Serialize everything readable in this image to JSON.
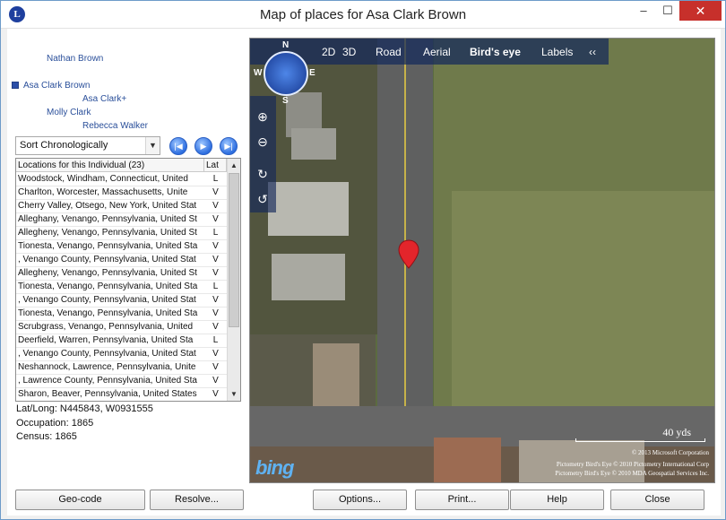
{
  "window": {
    "title": "Map of places for Asa Clark Brown",
    "app_icon": "L"
  },
  "titlebar": {
    "minimize": "–",
    "maximize": "☐",
    "close": "✕"
  },
  "tree": [
    {
      "label": "Nathan Brown",
      "selected": false
    },
    {
      "label": "Asa Clark Brown",
      "selected": true
    },
    {
      "label": "Asa Clark+",
      "selected": false
    },
    {
      "label": "Molly Clark",
      "selected": false
    },
    {
      "label": "Rebecca Walker",
      "selected": false
    }
  ],
  "sort": {
    "selected": "Sort Chronologically"
  },
  "nav_buttons": {
    "first": "|◀",
    "play": "▶",
    "last": "▶|"
  },
  "list": {
    "columns": [
      "Locations for this Individual (23)",
      "Lat"
    ],
    "rows": [
      {
        "location": "Woodstock, Windham, Connecticut, United",
        "lat": "L"
      },
      {
        "location": "Charlton, Worcester, Massachusetts, Unite",
        "lat": "V"
      },
      {
        "location": "Cherry Valley, Otsego, New York, United Stat",
        "lat": "V"
      },
      {
        "location": "Alleghany, Venango, Pennsylvania, United St",
        "lat": "V"
      },
      {
        "location": "Allegheny, Venango, Pennsylvania, United St",
        "lat": "L"
      },
      {
        "location": "Tionesta, Venango, Pennsylvania, United Sta",
        "lat": "V"
      },
      {
        "location": ", Venango County, Pennsylvania, United Stat",
        "lat": "V"
      },
      {
        "location": "Allegheny, Venango, Pennsylvania, United St",
        "lat": "V"
      },
      {
        "location": "Tionesta, Venango, Pennsylvania, United Sta",
        "lat": "L"
      },
      {
        "location": ", Venango County, Pennsylvania, United Stat",
        "lat": "V"
      },
      {
        "location": "Tionesta, Venango, Pennsylvania, United Sta",
        "lat": "V"
      },
      {
        "location": "Scrubgrass, Venango, Pennsylvania, United",
        "lat": "V"
      },
      {
        "location": "Deerfield, Warren, Pennsylvania, United Sta",
        "lat": "L"
      },
      {
        "location": ", Venango County, Pennsylvania, United Stat",
        "lat": "V"
      },
      {
        "location": "Neshannock, Lawrence, Pennsylvania, Unite",
        "lat": "V"
      },
      {
        "location": ", Lawrence County, Pennsylvania, United Sta",
        "lat": "V"
      },
      {
        "location": "Sharon, Beaver, Pennsylvania, United States",
        "lat": "V"
      }
    ]
  },
  "info": {
    "latlong": "Lat/Long: N445843, W0931555",
    "occupation": "Occupation: 1865",
    "census": "Census: 1865"
  },
  "map": {
    "tabs": [
      "2D",
      "3D",
      "Road",
      "Aerial",
      "Bird's eye",
      "Labels",
      "‹‹"
    ],
    "active_tab": "Bird's eye",
    "compass": {
      "n": "N",
      "s": "S",
      "e": "E",
      "w": "W"
    },
    "scale": "40 yds",
    "credits": [
      "© 2013 Microsoft Corporation",
      "Pictometry Bird's Eye © 2010 Pictometry International Corp",
      "Pictometry Bird's Eye © 2010 MDA Geospatial Services Inc."
    ],
    "logo": "bing"
  },
  "buttons": {
    "geocode": "Geo-code",
    "resolve": "Resolve...",
    "options": "Options...",
    "print": "Print...",
    "help": "Help",
    "close": "Close"
  }
}
